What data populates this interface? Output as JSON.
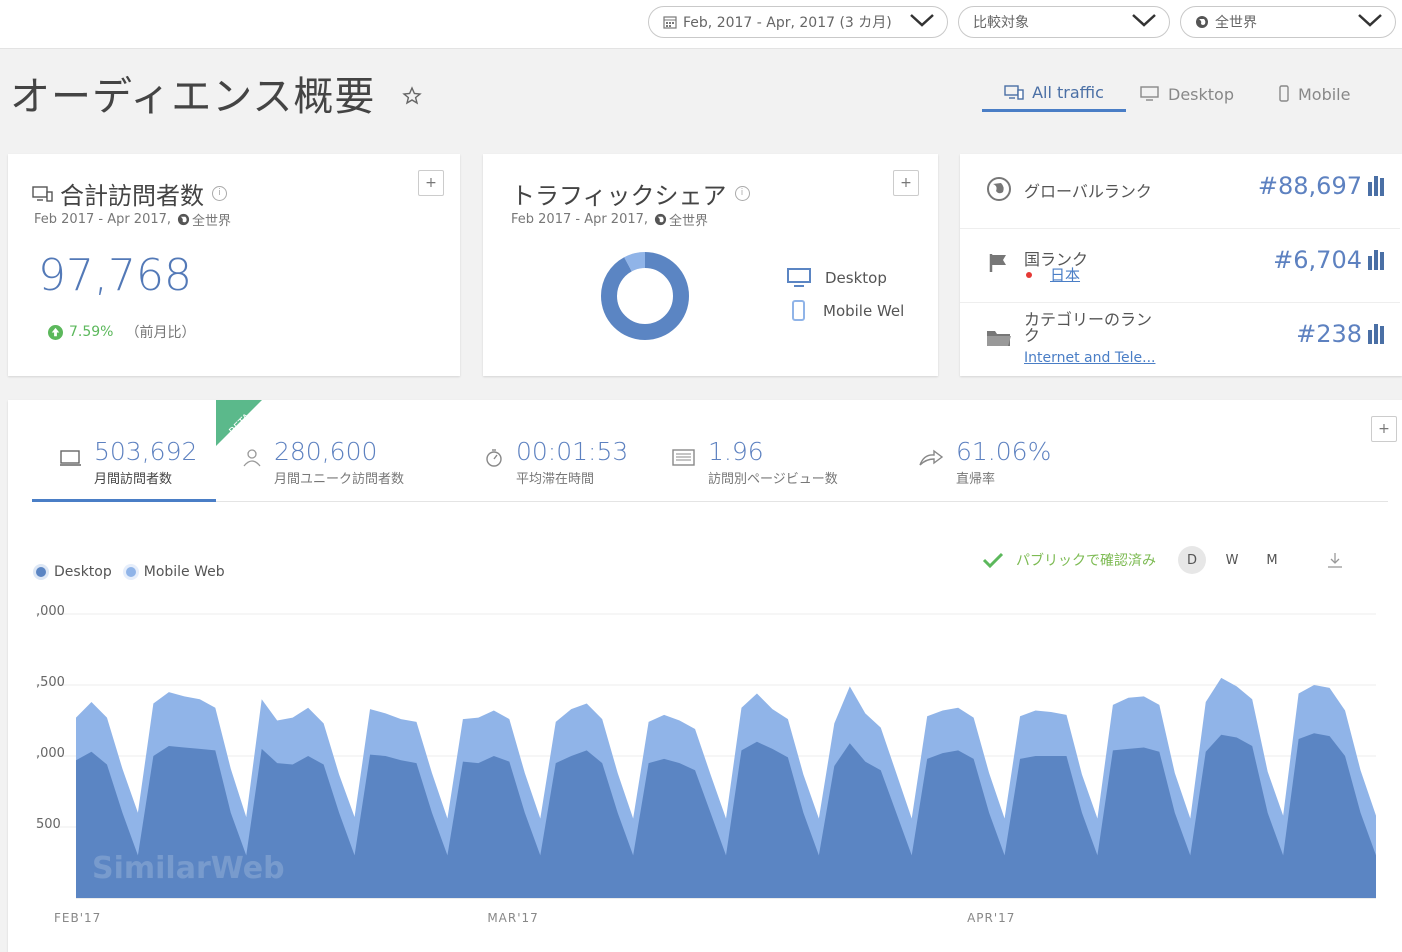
{
  "topbar": {
    "date_range": "Feb, 2017 - Apr, 2017 (3 カ月)",
    "compare": "比較対象",
    "region": "全世界"
  },
  "page": {
    "title": "オーディエンス概要"
  },
  "traffic_tabs": [
    "All traffic",
    "Desktop",
    "Mobile"
  ],
  "visits_card": {
    "title": "合計訪問者数",
    "subtitle_dates": "Feb 2017 - Apr 2017,",
    "subtitle_region": "全世界",
    "value": "97,768",
    "change": "7.59%",
    "change_label": "（前月比）"
  },
  "share_card": {
    "title": "トラフィックシェア",
    "subtitle_dates": "Feb 2017 - Apr 2017,",
    "subtitle_region": "全世界",
    "legend": [
      "Desktop",
      "Mobile Wel"
    ],
    "desktop_share": 0.92,
    "mobile_share": 0.08
  },
  "rank_card": {
    "global_label": "グローバルランク",
    "global_value": "#88,697",
    "country_label": "国ランク",
    "country_name": "日本",
    "country_value": "#6,704",
    "category_label_line1": "カテゴリーのラン",
    "category_label_line2": "ク",
    "category_name": "Internet and Tele...",
    "category_value": "#238"
  },
  "beta_badge": "BETA",
  "metrics": [
    {
      "value": "503,692",
      "label": "月間訪問者数"
    },
    {
      "value": "280,600",
      "label": "月間ユニーク訪問者数"
    },
    {
      "value": "00:01:53",
      "label": "平均滞在時間"
    },
    {
      "value": "1.96",
      "label": "訪問別ページビュー数"
    },
    {
      "value": "61.06%",
      "label": "直帰率"
    }
  ],
  "chart_controls": {
    "verified": "パブリックで確認済み",
    "periods": [
      "D",
      "W",
      "M"
    ]
  },
  "watermark": "SimilarWeb",
  "colors": {
    "desktop": "#5b85c3",
    "mobile": "#90b4e8",
    "accent": "#4a7ec6",
    "positive": "#5cb85c"
  },
  "chart_data": {
    "type": "area",
    "stacked": true,
    "legend_position": "top-left",
    "series": [
      {
        "name": "Desktop",
        "values": [
          970,
          1030,
          940,
          600,
          300,
          1000,
          1070,
          1060,
          1050,
          1040,
          600,
          300,
          1050,
          950,
          940,
          1000,
          940,
          600,
          300,
          1010,
          1000,
          970,
          950,
          600,
          300,
          960,
          950,
          1000,
          960,
          600,
          300,
          950,
          1000,
          1040,
          950,
          600,
          300,
          950,
          980,
          950,
          900,
          600,
          300,
          1040,
          1100,
          1050,
          990,
          600,
          300,
          930,
          1090,
          960,
          900,
          600,
          300,
          980,
          1020,
          1040,
          980,
          600,
          300,
          980,
          1000,
          1000,
          1000,
          600,
          300,
          1040,
          1050,
          1060,
          1030,
          600,
          300,
          1030,
          1150,
          1130,
          1070,
          600,
          300,
          1120,
          1160,
          1140,
          1000,
          600,
          300
        ]
      },
      {
        "name": "Mobile Web",
        "values": [
          300,
          350,
          330,
          310,
          300,
          370,
          380,
          360,
          350,
          300,
          310,
          270,
          350,
          300,
          330,
          340,
          290,
          270,
          270,
          320,
          300,
          290,
          290,
          280,
          260,
          300,
          320,
          320,
          300,
          280,
          260,
          290,
          330,
          330,
          310,
          280,
          260,
          290,
          310,
          300,
          290,
          270,
          260,
          300,
          340,
          280,
          270,
          270,
          260,
          300,
          400,
          340,
          300,
          280,
          260,
          300,
          300,
          300,
          290,
          280,
          260,
          300,
          320,
          310,
          290,
          270,
          260,
          320,
          360,
          360,
          330,
          280,
          260,
          350,
          400,
          360,
          330,
          290,
          280,
          320,
          340,
          340,
          320,
          300,
          280
        ]
      }
    ],
    "y_tick_labels": [
      ",000",
      ",500",
      ",000",
      "500"
    ],
    "ylim": [
      0,
      2000
    ],
    "x_tick_labels": [
      "FEB'17",
      "MAR'17",
      "APR'17"
    ],
    "x_tick_index": [
      0,
      28,
      59
    ],
    "grid": true
  }
}
